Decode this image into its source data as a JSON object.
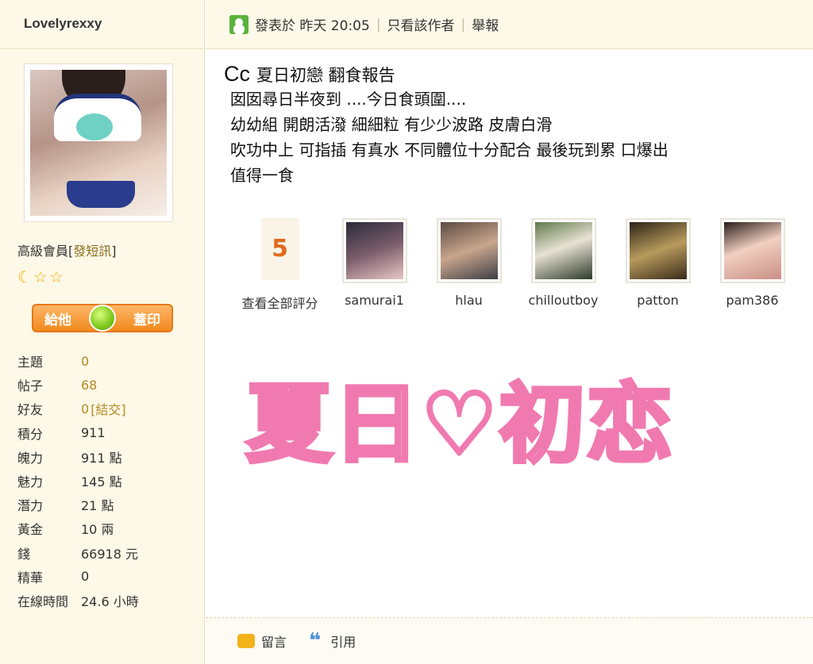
{
  "sidebar": {
    "username": "Lovelyrexxy",
    "rank": "高級會員",
    "rank_link": "發短訊",
    "gift_left": "給他",
    "gift_right": "蓋印",
    "stats": [
      {
        "label": "主題",
        "value": "0",
        "accent": true
      },
      {
        "label": "帖子",
        "value": "68",
        "accent": true
      },
      {
        "label": "好友",
        "value": "0",
        "accent": true,
        "extra": "[結交]"
      },
      {
        "label": "積分",
        "value": "911",
        "accent": false
      },
      {
        "label": "魄力",
        "value": "911 點",
        "accent": false
      },
      {
        "label": "魅力",
        "value": "145 點",
        "accent": false
      },
      {
        "label": "潛力",
        "value": "21 點",
        "accent": false
      },
      {
        "label": "黃金",
        "value": "10 兩",
        "accent": false
      },
      {
        "label": "錢",
        "value": "66918 元",
        "accent": false
      },
      {
        "label": "精華",
        "value": "0",
        "accent": false
      },
      {
        "label": "在線時間",
        "value": "24.6 小時",
        "accent": false
      }
    ]
  },
  "post_header": {
    "posted_at": "發表於 昨天 20:05",
    "only_author": "只看該作者",
    "report": "舉報"
  },
  "post": {
    "title_prefix": "Cc",
    "title": "夏日初戀  翻食報告",
    "lines": [
      "囡囡尋日半夜到 ....今日食頭圍....",
      "幼幼組 開朗活潑 細細粒  有少少波路 皮膚白滑",
      "吹功中上 可指插 有真水 不同體位十分配合   最後玩到累 口爆出",
      "值得一食"
    ],
    "overlay_text": "夏日♡初恋"
  },
  "ratings": {
    "count": "5",
    "view_all": "查看全部評分",
    "users": [
      "samurai1",
      "hlau",
      "chilloutboy",
      "patton",
      "pam386"
    ]
  },
  "footer": {
    "reply": "留言",
    "quote": "引用"
  }
}
